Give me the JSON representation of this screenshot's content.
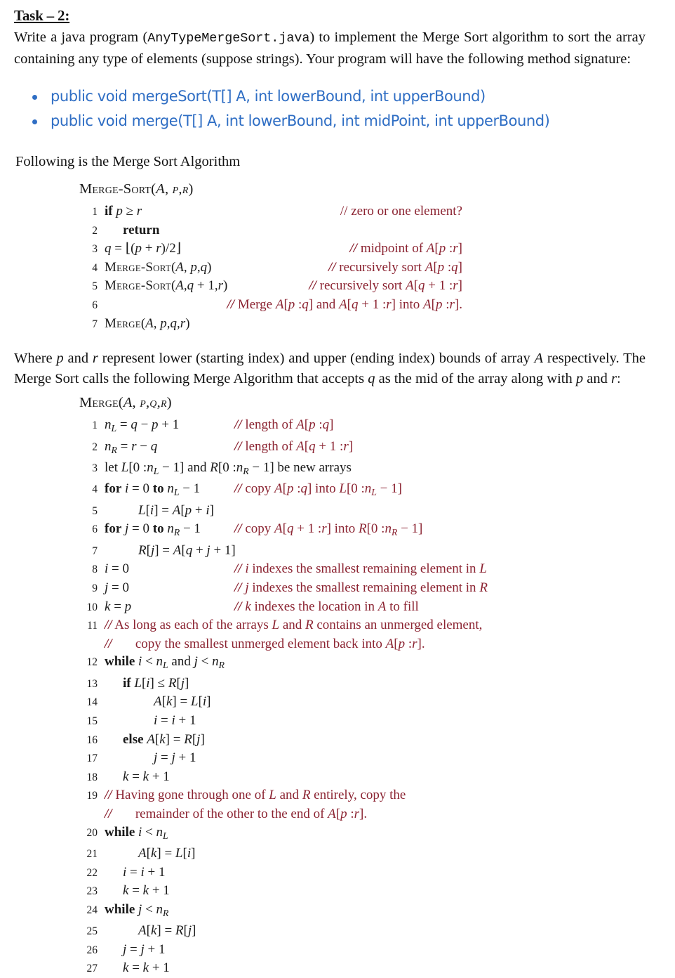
{
  "document": {
    "task_title": "Task – 2:",
    "intro_before_code": "Write a java program (",
    "intro_code": "AnyTypeMergeSort.java",
    "intro_after_code": ") to implement the Merge Sort algorithm to sort the array containing any type of elements (suppose strings). Your program will have the following method signature:",
    "method_signatures": [
      "public void mergeSort(T[] A, int lowerBound, int upperBound)",
      "public void merge(T[] A, int lowerBound, int midPoint, int upperBound)"
    ],
    "lead_in": "Following is the Merge Sort Algorithm",
    "middle_paragraph": "Where p and r represent lower (starting index) and upper (ending index) bounds of array A respectively. The Merge Sort calls the following Merge Algorithm that accepts q as the mid of the array along with p and r:",
    "accent_blue": "#2f6ec4",
    "comment_maroon": "#8b2331"
  },
  "merge_sort_algorithm": {
    "title": "MERGE-SORT(A, p, r)",
    "lines": [
      {
        "num": "1",
        "code": "if p ≥ r",
        "comment": "// zero or one element?"
      },
      {
        "num": "2",
        "code": "return",
        "comment": ""
      },
      {
        "num": "3",
        "code": "q = ⌊(p + r)/2⌋",
        "comment": "// midpoint of A[p : r]"
      },
      {
        "num": "4",
        "code": "MERGE-SORT(A, p, q)",
        "comment": "// recursively sort A[p : q]"
      },
      {
        "num": "5",
        "code": "MERGE-SORT(A, q + 1, r)",
        "comment": "// recursively sort A[q + 1 : r]"
      },
      {
        "num": "6",
        "code": "",
        "comment": "// Merge A[p : q] and A[q + 1 : r] into A[p : r]."
      },
      {
        "num": "7",
        "code": "MERGE(A, p, q, r)",
        "comment": ""
      }
    ]
  },
  "merge_algorithm": {
    "title": "MERGE(A, p, q, r)",
    "lines": [
      {
        "num": "1",
        "code": "nL = q − p + 1",
        "comment": "// length of A[p : q]"
      },
      {
        "num": "2",
        "code": "nR = r − q",
        "comment": "// length of A[q + 1 : r]"
      },
      {
        "num": "3",
        "code": "let L[0 : nL − 1] and R[0 : nR − 1] be new arrays",
        "comment": ""
      },
      {
        "num": "4",
        "code": "for i = 0 to nL − 1",
        "comment": "// copy A[p : q] into L[0 : nL − 1]"
      },
      {
        "num": "5",
        "code": "L[i] = A[p + i]",
        "comment": ""
      },
      {
        "num": "6",
        "code": "for j = 0 to nR − 1",
        "comment": "// copy A[q + 1 : r] into R[0 : nR − 1]"
      },
      {
        "num": "7",
        "code": "R[j] = A[q + j + 1]",
        "comment": ""
      },
      {
        "num": "8",
        "code": "i = 0",
        "comment": "// i indexes the smallest remaining element in L"
      },
      {
        "num": "9",
        "code": "j = 0",
        "comment": "// j indexes the smallest remaining element in R"
      },
      {
        "num": "10",
        "code": "k = p",
        "comment": "// k indexes the location in A to fill"
      },
      {
        "num": "11",
        "code": "",
        "comment": "// As long as each of the arrays L and R contains an unmerged element,"
      },
      {
        "num": "",
        "code": "",
        "comment": "//      copy the smallest unmerged element back into A[p : r]."
      },
      {
        "num": "12",
        "code": "while i < nL and j < nR",
        "comment": ""
      },
      {
        "num": "13",
        "code": "if L[i] ≤ R[j]",
        "comment": ""
      },
      {
        "num": "14",
        "code": "A[k] = L[i]",
        "comment": ""
      },
      {
        "num": "15",
        "code": "i = i + 1",
        "comment": ""
      },
      {
        "num": "16",
        "code": "else A[k] = R[j]",
        "comment": ""
      },
      {
        "num": "17",
        "code": "j = j + 1",
        "comment": ""
      },
      {
        "num": "18",
        "code": "k = k + 1",
        "comment": ""
      },
      {
        "num": "19",
        "code": "",
        "comment": "// Having gone through one of L and R entirely, copy the"
      },
      {
        "num": "",
        "code": "",
        "comment": "//      remainder of the other to the end of A[p : r]."
      },
      {
        "num": "20",
        "code": "while i < nL",
        "comment": ""
      },
      {
        "num": "21",
        "code": "A[k] = L[i]",
        "comment": ""
      },
      {
        "num": "22",
        "code": "i = i + 1",
        "comment": ""
      },
      {
        "num": "23",
        "code": "k = k + 1",
        "comment": ""
      },
      {
        "num": "24",
        "code": "while j < nR",
        "comment": ""
      },
      {
        "num": "25",
        "code": "A[k] = R[j]",
        "comment": ""
      },
      {
        "num": "26",
        "code": "j = j + 1",
        "comment": ""
      },
      {
        "num": "27",
        "code": "k = k + 1",
        "comment": ""
      }
    ]
  }
}
